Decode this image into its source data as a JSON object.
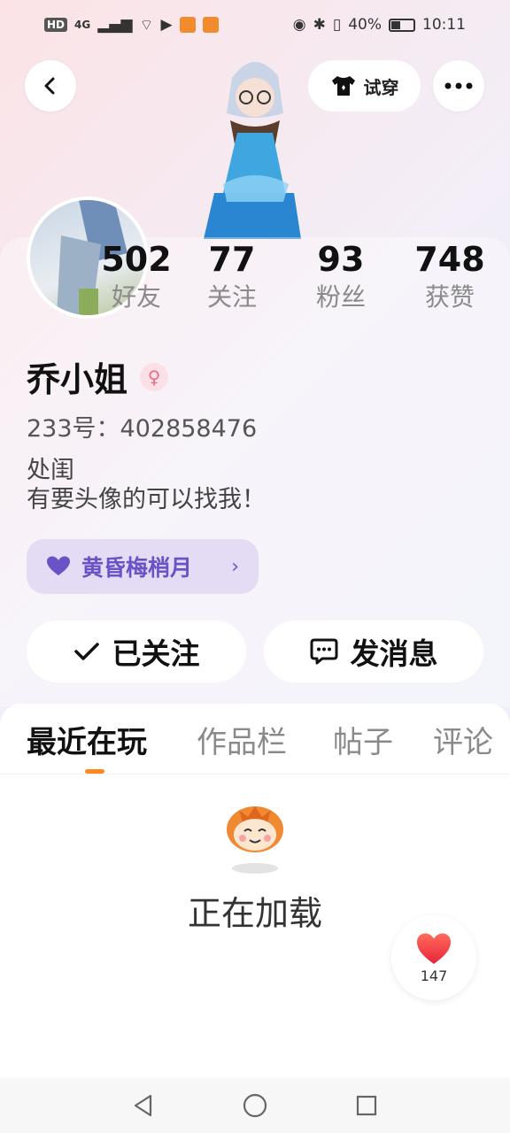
{
  "status_bar": {
    "network": "4G",
    "battery": "40%",
    "time": "10:11",
    "hd_label": "HD"
  },
  "header": {
    "tryon_label": "试穿"
  },
  "profile": {
    "stats": [
      {
        "value": "502",
        "label": "好友"
      },
      {
        "value": "77",
        "label": "关注"
      },
      {
        "value": "93",
        "label": "粉丝"
      },
      {
        "value": "748",
        "label": "获赞"
      }
    ],
    "name": "乔小姐",
    "id_line": "233号：402858476",
    "bio_line1": "处闺",
    "bio_line2": "有要头像的可以找我！",
    "badge_label": "黄昏梅梢月"
  },
  "actions": {
    "following_label": "已关注",
    "message_label": "发消息"
  },
  "tabs": [
    "最近在玩",
    "作品栏",
    "帖子",
    "评论"
  ],
  "loading_text": "正在加载",
  "like_count": "147",
  "colors": {
    "accent": "#ff8a1c",
    "badge": "#6a52c7",
    "like": "#f2413f"
  }
}
